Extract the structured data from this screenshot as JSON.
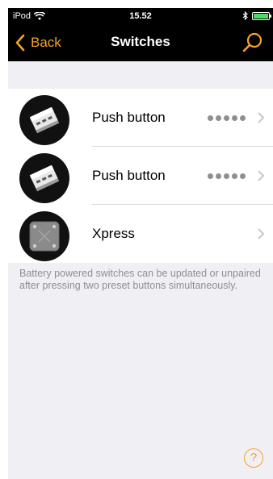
{
  "status_bar": {
    "carrier": "iPod",
    "time": "15.52",
    "icons": [
      "wifi-icon",
      "bluetooth-icon",
      "battery-icon"
    ]
  },
  "nav": {
    "back_label": "Back",
    "title": "Switches",
    "search_icon": "search-icon"
  },
  "switches": [
    {
      "label": "Push button",
      "signal_dots": 5,
      "icon": "push-button-switch-icon"
    },
    {
      "label": "Push button",
      "signal_dots": 5,
      "icon": "push-button-switch-icon"
    },
    {
      "label": "Xpress",
      "signal_dots": 0,
      "icon": "xpress-switch-icon"
    }
  ],
  "footer_note": "Battery powered switches can be updated or unpaired after pressing two preset buttons simultaneously.",
  "help_label": "?",
  "colors": {
    "accent": "#f7a325",
    "nav_background": "#000000",
    "page_background": "#efeff4",
    "signal_dots": "#8e8e93"
  }
}
